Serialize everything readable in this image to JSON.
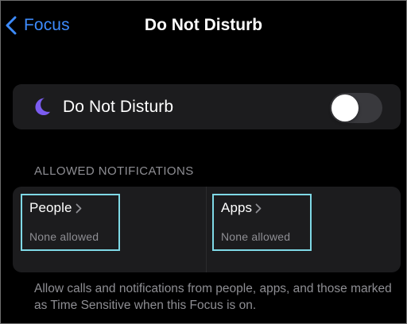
{
  "nav": {
    "back_label": "Focus",
    "title": "Do Not Disturb",
    "back_icon": "chevron-left-icon"
  },
  "focus_toggle": {
    "icon": "moon-icon",
    "label": "Do Not Disturb",
    "enabled": false
  },
  "allowed_notifications": {
    "header": "ALLOWED NOTIFICATIONS",
    "people": {
      "title": "People",
      "subtitle": "None allowed"
    },
    "apps": {
      "title": "Apps",
      "subtitle": "None allowed"
    }
  },
  "footer_text": "Allow calls and notifications from people, apps, and those marked as Time Sensitive when this Focus is on.",
  "colors": {
    "accent": "#3d8bfd",
    "moon": "#7b5cf0",
    "highlight": "#7fd9e6"
  }
}
